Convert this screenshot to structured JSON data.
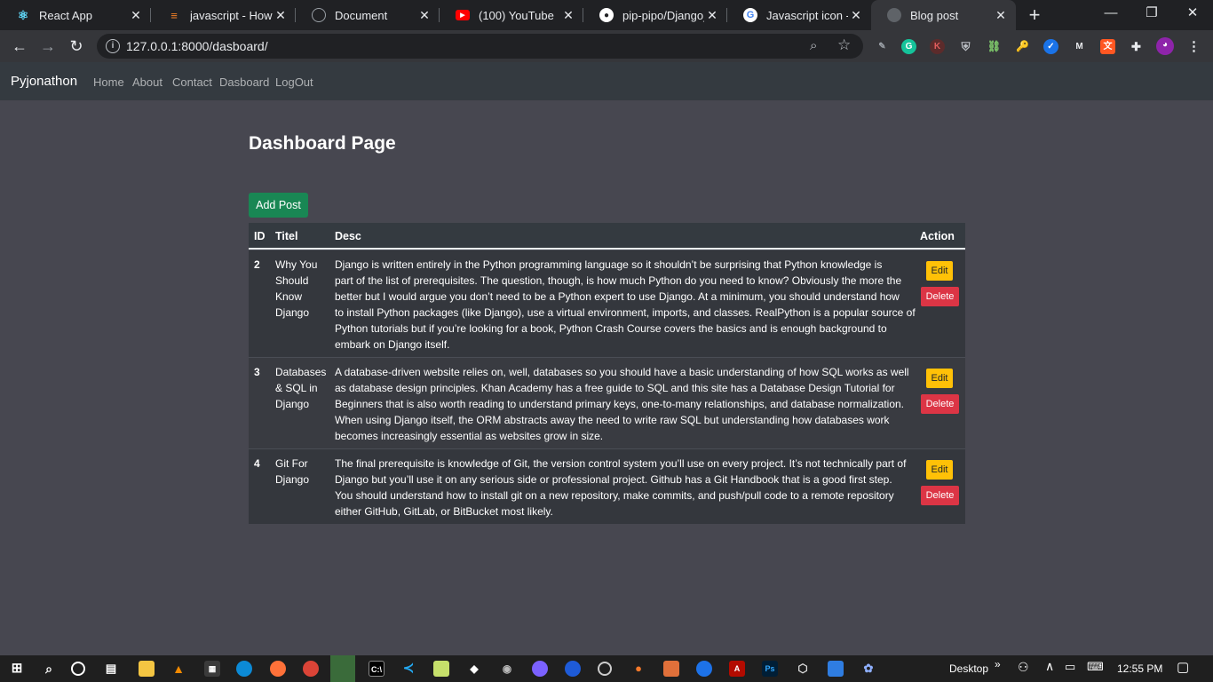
{
  "browser": {
    "tabs": [
      {
        "label": "React App",
        "icon": "react-icon",
        "color": "#61dafb"
      },
      {
        "label": "javascript - How to",
        "icon": "stackoverflow-icon",
        "color": "#f48024"
      },
      {
        "label": "Document",
        "icon": "globe-icon",
        "color": "#5f6368"
      },
      {
        "label": "(100) YouTube",
        "icon": "youtube-icon",
        "color": "#ff0000"
      },
      {
        "label": "pip-pipo/Django_B",
        "icon": "github-icon",
        "color": "#ffffff"
      },
      {
        "label": "Javascript icon - G",
        "icon": "google-icon",
        "color": "#4285f4"
      },
      {
        "label": "Blog post",
        "icon": "globe-icon",
        "color": "#5f6368"
      }
    ],
    "address": "127.0.0.1:8000/dasboard/",
    "controls": {
      "minimize": "—",
      "maximize": "❐",
      "close": "✕",
      "new_tab": "+"
    }
  },
  "site": {
    "brand": "Pyjonathon",
    "nav": [
      "Home",
      "About",
      "Contact",
      "Dasboard",
      "LogOut"
    ],
    "page_title": "Dashboard Page",
    "add_button": "Add Post"
  },
  "table": {
    "headers": {
      "id": "ID",
      "title": "Titel",
      "desc": "Desc",
      "action": "Action"
    },
    "edit_label": "Edit",
    "delete_label": "Delete",
    "rows": [
      {
        "id": "2",
        "title_lines": [
          "Why You",
          "Should",
          "Know",
          "Django"
        ],
        "desc_lines": [
          "Django is written entirely in the Python programming language so it shouldn’t be surprising that Python knowledge is",
          "part of the list of prerequisites. The question, though, is how much Python do you need to know? Obviously the more the",
          "better but I would argue you don’t need to be a Python expert to use Django. At a minimum, you should understand how",
          "to install Python packages (like Django), use a virtual environment, imports, and classes. RealPython is a popular source of",
          "Python tutorials but if you’re looking for a book, Python Crash Course covers the basics and is enough background to",
          "embark on Django itself."
        ]
      },
      {
        "id": "3",
        "title_lines": [
          "Databases",
          "& SQL in",
          "Django"
        ],
        "desc_lines": [
          "A database-driven website relies on, well, databases so you should have a basic understanding of how SQL works as well",
          "as database design principles. Khan Academy has a free guide to SQL and this site has a Database Design Tutorial for",
          "Beginners that is also worth reading to understand primary keys, one-to-many relationships, and database normalization.",
          "When using Django itself, the ORM abstracts away the need to write raw SQL but understanding how databases work",
          "becomes increasingly essential as websites grow in size."
        ]
      },
      {
        "id": "4",
        "title_lines": [
          "Git For",
          "Django"
        ],
        "desc_lines": [
          "The final prerequisite is knowledge of Git, the version control system you’ll use on every project. It’s not technically part of",
          "Django but you’ll use it on any serious side or professional project. Github has a Git Handbook that is a good first step.",
          "You should understand how to install git on a new repository, make commits, and push/pull code to a remote repository",
          "either GitHub, GitLab, or BitBucket most likely."
        ]
      }
    ]
  },
  "taskbar": {
    "desktop_label": "Desktop",
    "time": "12:55 PM"
  },
  "colors": {
    "page_bg": "#474750",
    "navbar_bg": "#343a40",
    "success": "#198754",
    "warning": "#ffc107",
    "danger": "#dc3545"
  }
}
